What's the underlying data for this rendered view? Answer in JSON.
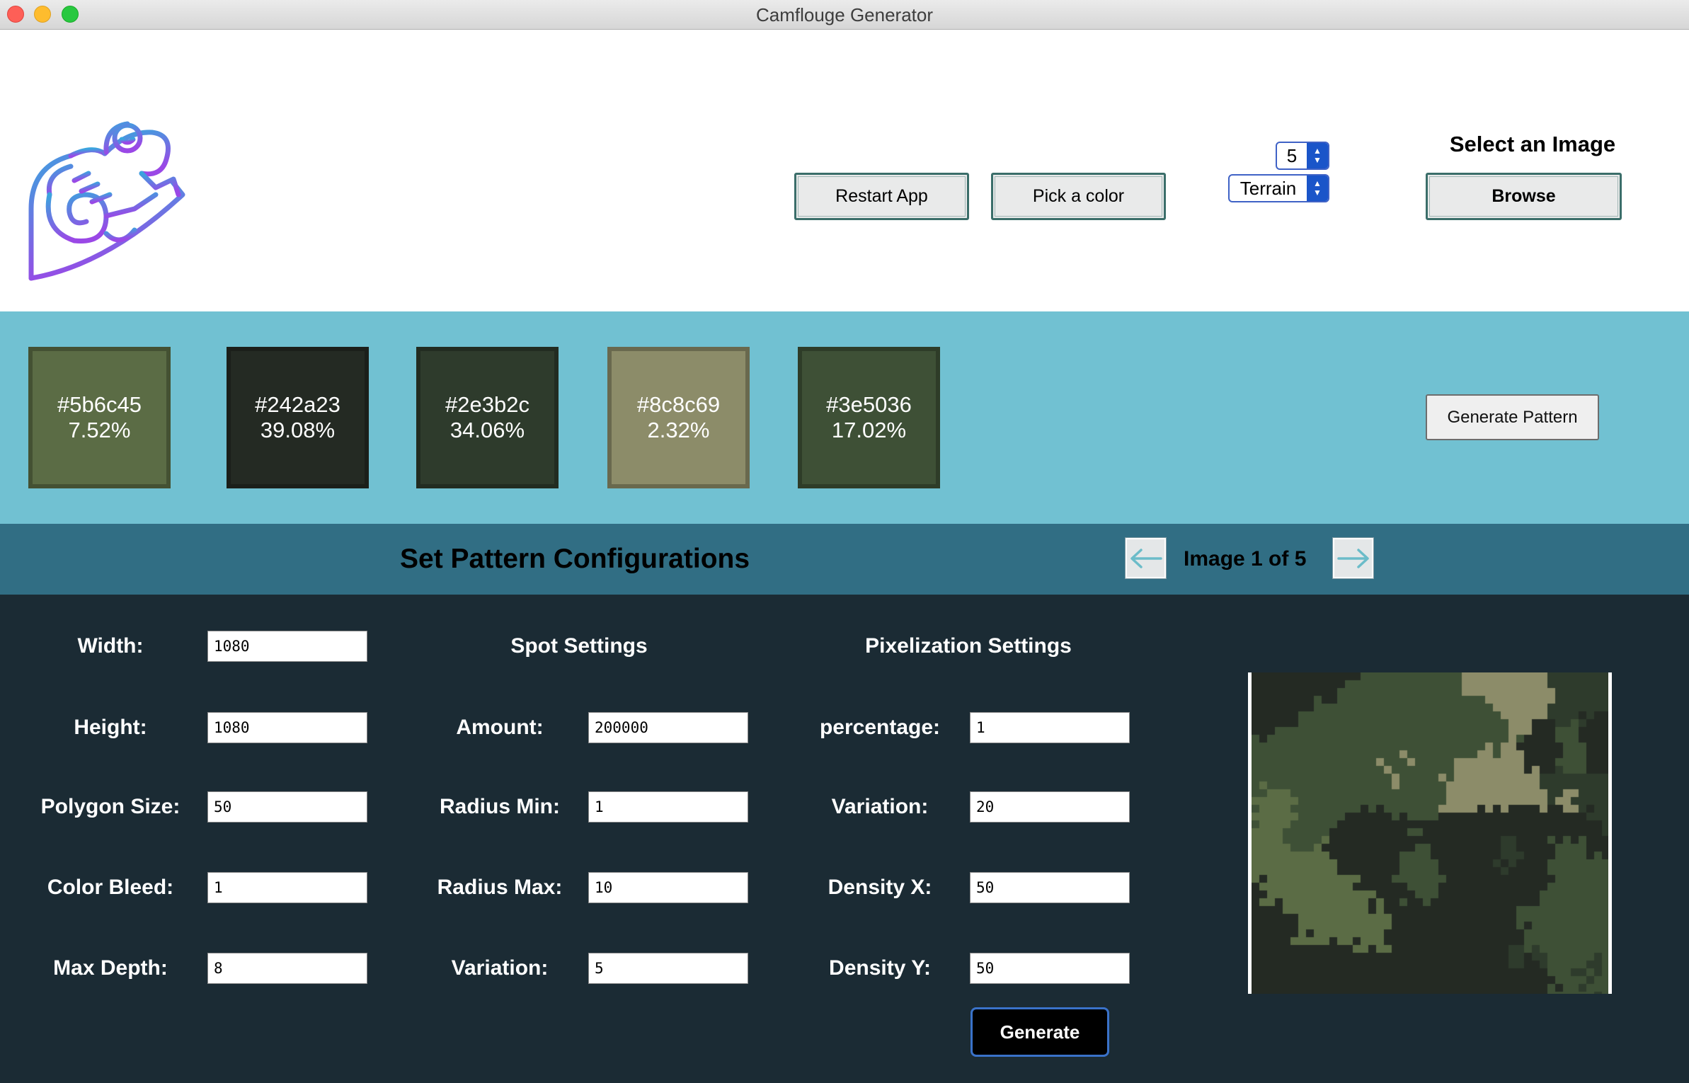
{
  "window": {
    "title": "Camflouge Generator",
    "traffic_colors": {
      "close": "#fe5f57",
      "minimize": "#febc2e",
      "maximize": "#28c840"
    }
  },
  "header": {
    "restart_label": "Restart App",
    "pick_color_label": "Pick a color",
    "count_value": "5",
    "mode_value": "Terrain",
    "select_image_label": "Select an Image",
    "browse_label": "Browse"
  },
  "palette": {
    "colors": [
      {
        "hex": "#5b6c45",
        "label": "#5b6c45",
        "pct": "7.52%"
      },
      {
        "hex": "#242a23",
        "label": "#242a23",
        "pct": "39.08%"
      },
      {
        "hex": "#2e3b2c",
        "label": "#2e3b2c",
        "pct": "34.06%"
      },
      {
        "hex": "#8c8c69",
        "label": "#8c8c69",
        "pct": "2.32%"
      },
      {
        "hex": "#3e5036",
        "label": "#3e5036",
        "pct": "17.02%"
      }
    ],
    "generate_pattern_label": "Generate Pattern"
  },
  "config": {
    "title": "Set Pattern Configurations",
    "image_counter": "Image 1 of 5",
    "prev_icon": "arrow-left-icon",
    "next_icon": "arrow-right-icon"
  },
  "form": {
    "general": [
      {
        "label": "Width:",
        "value": "1080"
      },
      {
        "label": "Height:",
        "value": "1080"
      },
      {
        "label": "Polygon Size:",
        "value": "50"
      },
      {
        "label": "Color Bleed:",
        "value": "1"
      },
      {
        "label": "Max Depth:",
        "value": "8"
      }
    ],
    "spot_title": "Spot Settings",
    "spot": [
      {
        "label": "Amount:",
        "value": "200000"
      },
      {
        "label": "Radius Min:",
        "value": "1"
      },
      {
        "label": "Radius Max:",
        "value": "10"
      },
      {
        "label": "Variation:",
        "value": "5"
      }
    ],
    "pixel_title": "Pixelization Settings",
    "pixel": [
      {
        "label": "percentage:",
        "value": "1"
      },
      {
        "label": "Variation:",
        "value": "20"
      },
      {
        "label": "Density X:",
        "value": "50"
      },
      {
        "label": "Density Y:",
        "value": "50"
      }
    ],
    "generate_label": "Generate"
  },
  "preview": {
    "palette": [
      "#5b6c45",
      "#242a23",
      "#2e3b2c",
      "#8c8c69",
      "#3e5036"
    ]
  }
}
